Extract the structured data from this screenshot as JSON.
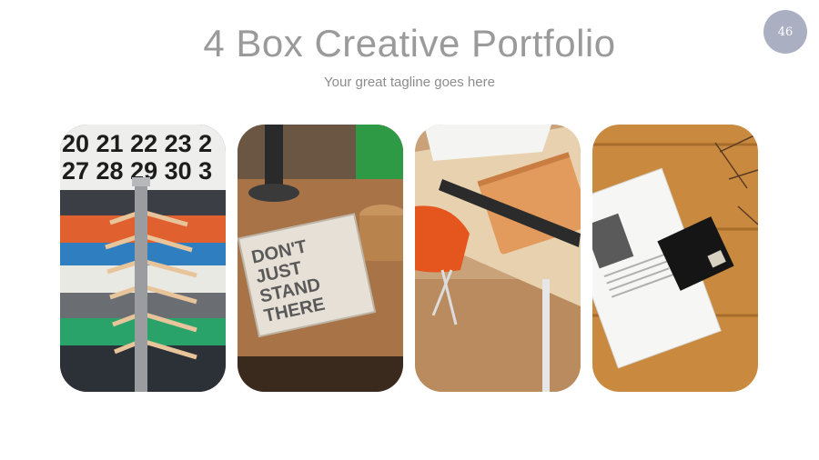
{
  "slide": {
    "title": "4 Box Creative Portfolio",
    "tagline": "Your great tagline goes here",
    "page_number": "46"
  },
  "gallery": {
    "items": [
      {
        "subject": "clothing rack with shirts on hangers in front of a calendar",
        "calendar_row_1": "20 21 22 23 2",
        "calendar_row_2": "27 28 29 30 3"
      },
      {
        "subject": "notebook on wooden desk with lettering",
        "notebook_text": [
          "DON'T",
          "JUST",
          "STAND",
          "THERE"
        ]
      },
      {
        "subject": "orange chair at desk with leather notebook and ruler"
      },
      {
        "subject": "open magazine and black card on wooden table"
      }
    ]
  }
}
